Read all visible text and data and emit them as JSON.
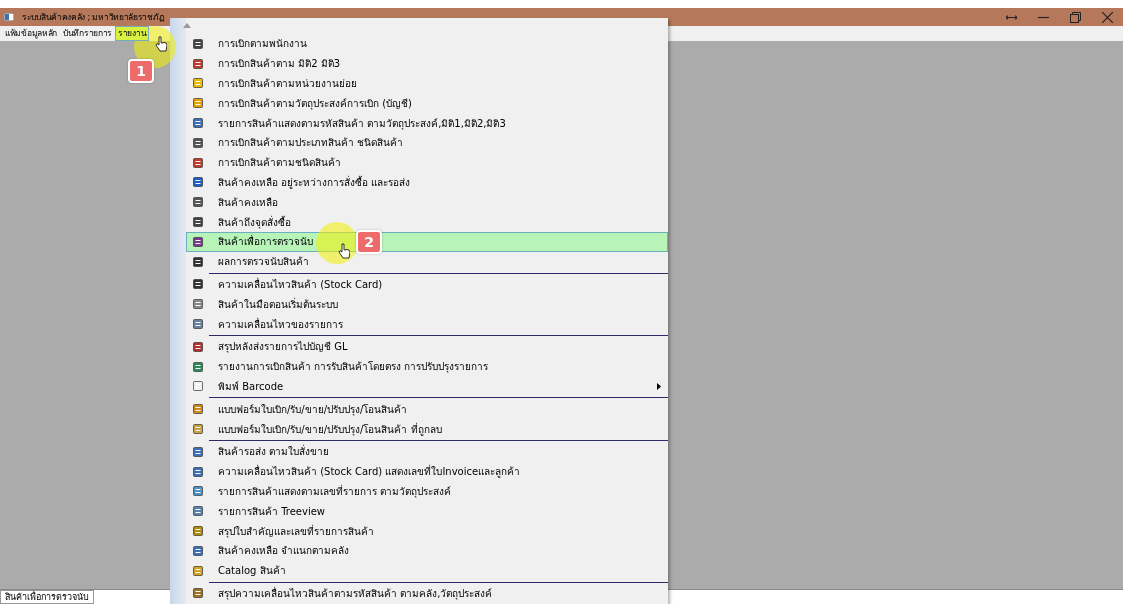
{
  "window": {
    "title": "ระบบสินค้าคงคลัง ; มหาวิทยาลัยราชภัฏ"
  },
  "menu_bar": [
    {
      "label": "แฟ้มข้อมูลหลัก",
      "selected": false
    },
    {
      "label": "บันทึกรายการ",
      "selected": false
    },
    {
      "label": "รายงาน",
      "selected": true
    }
  ],
  "menu": {
    "groups": [
      {
        "items": [
          {
            "label": "การเบิกตามพนักงาน",
            "selected": false,
            "kind": "item"
          },
          {
            "label": "การเบิกสินค้าตาม มิติ2 มิติ3",
            "selected": false,
            "kind": "item"
          },
          {
            "label": "การเบิกสินค้าตามหน่วยงานย่อย",
            "selected": false,
            "kind": "item"
          },
          {
            "label": "การเบิกสินค้าตามวัตถุประสงค์การเบิก (บัญชี)",
            "selected": false,
            "kind": "item"
          },
          {
            "label": "รายการสินค้าแสดงตามรหัสสินค้า  ตามวัตถุประสงค์,มิติ1,มิติ2,มิติ3",
            "selected": false,
            "kind": "item"
          },
          {
            "label": "การเบิกสินค้าตามประเภทสินค้า ชนิดสินค้า",
            "selected": false,
            "kind": "item"
          },
          {
            "label": "การเบิกสินค้าตามชนิดสินค้า",
            "selected": false,
            "kind": "item"
          },
          {
            "label": "สินค้าคงเหลือ อยู่ระหว่างการสั่งซื้อ และรอส่ง",
            "selected": false,
            "kind": "item"
          },
          {
            "label": "สินค้าคงเหลือ",
            "selected": false,
            "kind": "item"
          },
          {
            "label": "สินค้าถึงจุดสั่งซื้อ",
            "selected": false,
            "kind": "item"
          },
          {
            "label": "สินค้าเพื่อการตรวจนับ",
            "selected": true,
            "kind": "item"
          },
          {
            "label": "ผลการตรวจนับสินค้า",
            "selected": false,
            "kind": "item"
          }
        ]
      },
      {
        "items": [
          {
            "label": "ความเคลื่อนไหวสินค้า  (Stock Card)",
            "selected": false,
            "kind": "item"
          },
          {
            "label": "สินค้าในมือตอนเริ่มต้นระบบ",
            "selected": false,
            "kind": "item"
          },
          {
            "label": "ความเคลื่อนไหวของรายการ",
            "selected": false,
            "kind": "item"
          }
        ]
      },
      {
        "items": [
          {
            "label": "สรุปหลังส่งรายการไปบัญชี GL",
            "selected": false,
            "kind": "item"
          },
          {
            "label": "รายงานการเบิกสินค้า การรับสินค้าโดยตรง การปรับปรุงรายการ",
            "selected": false,
            "kind": "item"
          },
          {
            "label": "พิมพ์ Barcode",
            "selected": false,
            "kind": "submenu"
          }
        ]
      },
      {
        "items": [
          {
            "label": "แบบฟอร์มใบเบิก/รับ/ขาย/ปรับปรุง/โอนสินค้า",
            "selected": false,
            "kind": "item"
          },
          {
            "label": "แบบฟอร์มใบเบิก/รับ/ขาย/ปรับปรุง/โอนสินค้า ที่ถูกลบ",
            "selected": false,
            "kind": "item"
          }
        ]
      },
      {
        "items": [
          {
            "label": "สินค้ารอส่ง ตามใบสั่งขาย",
            "selected": false,
            "kind": "item"
          },
          {
            "label": "ความเคลื่อนไหวสินค้า  (Stock  Card) แสดงเลขที่ใบInvoiceและลูกค้า",
            "selected": false,
            "kind": "item"
          },
          {
            "label": "รายการสินค้าแสดงตามเลขที่รายการ ตามวัตถุประสงค์",
            "selected": false,
            "kind": "item"
          },
          {
            "label": "รายการสินค้า Treeview",
            "selected": false,
            "kind": "item"
          },
          {
            "label": "สรุปใบสำคัญและเลขที่รายการสินค้า",
            "selected": false,
            "kind": "item"
          },
          {
            "label": "สินค้าคงเหลือ จำแนกตามคลัง",
            "selected": false,
            "kind": "item"
          },
          {
            "label": "Catalog สินค้า",
            "selected": false,
            "kind": "item"
          }
        ]
      },
      {
        "items": [
          {
            "label": "สรุปความเคลื่อนไหวสินค้าตามรหัสสินค้า  ตามคลัง,วัตถุประสงค์",
            "selected": false,
            "kind": "item"
          }
        ]
      }
    ]
  },
  "status_bar": {
    "text": "สินค้าเพื่อการตรวจนับ"
  },
  "annotations": [
    {
      "label": "1"
    },
    {
      "label": "2"
    }
  ]
}
